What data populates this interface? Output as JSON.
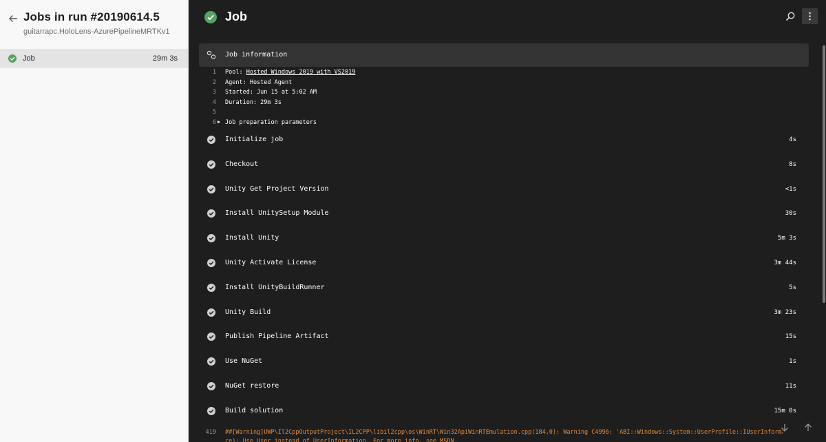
{
  "sidebar": {
    "title": "Jobs in run #20190614.5",
    "subtitle": "guitarrapc.HoloLens-AzurePipelineMRTKv1",
    "job": {
      "label": "Job",
      "duration": "29m 3s"
    }
  },
  "main": {
    "title": "Job",
    "info_label": "Job information",
    "log": [
      {
        "n": "1",
        "prefix": "Pool: ",
        "link": "Hosted Windows 2019 with VS2019"
      },
      {
        "n": "2",
        "text": "Agent: Hosted Agent"
      },
      {
        "n": "3",
        "text": "Started: Jun 15 at 5:02 AM"
      },
      {
        "n": "4",
        "text": "Duration: 29m 3s"
      },
      {
        "n": "5",
        "text": ""
      },
      {
        "n": "6",
        "text": "Job preparation parameters"
      }
    ],
    "steps": [
      {
        "name": "Initialize job",
        "duration": "4s"
      },
      {
        "name": "Checkout",
        "duration": "8s"
      },
      {
        "name": "Unity Get Project Version",
        "duration": "<1s"
      },
      {
        "name": "Install UnitySetup Module",
        "duration": "30s"
      },
      {
        "name": "Install Unity",
        "duration": "5m 3s"
      },
      {
        "name": "Unity Activate License",
        "duration": "3m 44s"
      },
      {
        "name": "Install UnityBuildRunner",
        "duration": "5s"
      },
      {
        "name": "Unity Build",
        "duration": "3m 23s"
      },
      {
        "name": "Publish Pipeline Artifact",
        "duration": "15s"
      },
      {
        "name": "Use NuGet",
        "duration": "1s"
      },
      {
        "name": "NuGet restore",
        "duration": "11s"
      },
      {
        "name": "Build solution",
        "duration": "15m 0s"
      }
    ],
    "warning": {
      "n": "419",
      "text": "##[Warning]UWP\\Il2CppOutputProject\\IL2CPP\\libil2cpp\\os\\WinRT\\Win32ApiWinRTEmulation.cpp(184,0): Warning C4996: 'ABI::Windows::System::UserProfile::IUserInformationStatics'",
      "text2": "ce): Use User instead of UserInformation. For more info, see MSDN."
    }
  },
  "colors": {
    "success": "#55a362",
    "step_check": "#d0d0d0",
    "warning": "#e58b3a"
  }
}
